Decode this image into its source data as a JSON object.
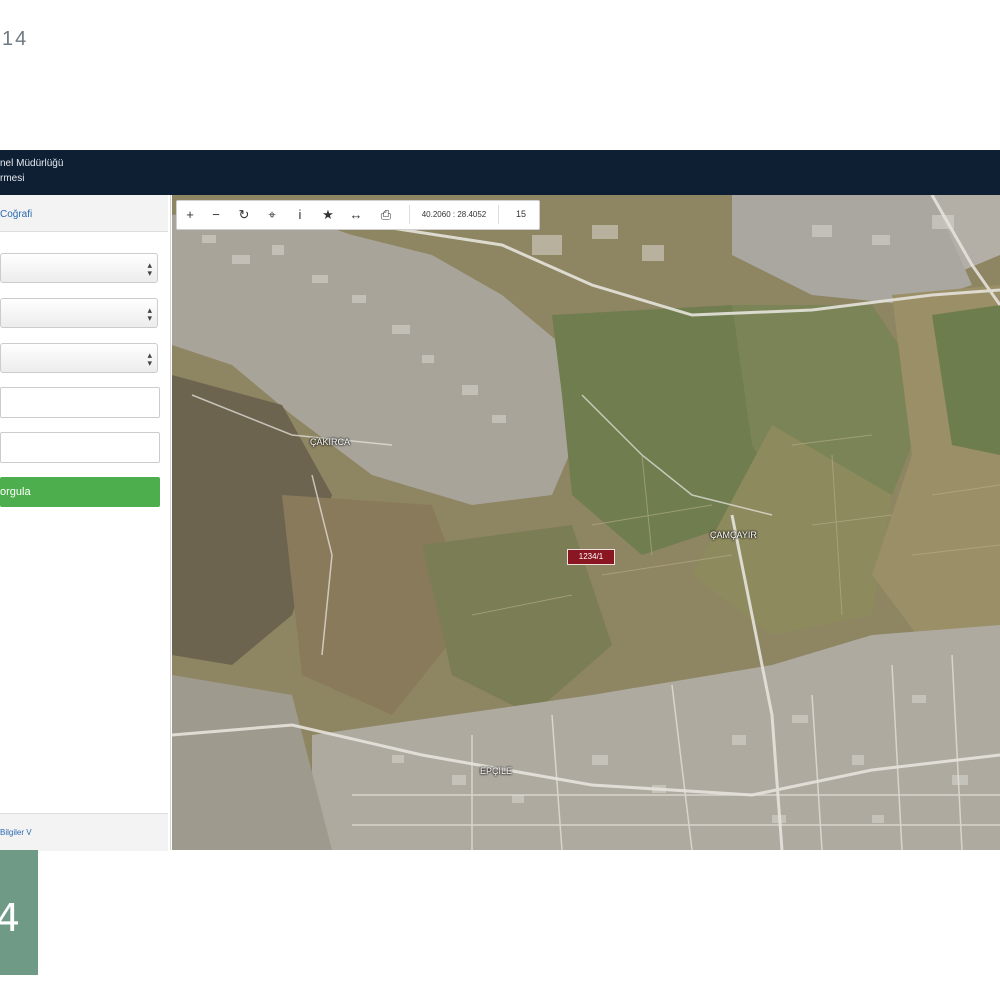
{
  "page": {
    "corner_number": "14"
  },
  "header": {
    "title_line1": "nel Müdürlüğü",
    "title_line2": "rmesi"
  },
  "sidebar": {
    "section_title": "Coğrafi",
    "selects": [
      "",
      "",
      ""
    ],
    "inputs": [
      "",
      ""
    ],
    "query_button": "orgula",
    "footer_link": "Bilgiler V"
  },
  "toolbar": {
    "icons": [
      "zoom-in-icon",
      "zoom-out-icon",
      "refresh-icon",
      "locate-icon",
      "info-icon",
      "star-icon",
      "measure-icon",
      "print-icon"
    ],
    "glyphs": [
      "+",
      "−",
      "↻",
      "⌖",
      "i",
      "★",
      "↔",
      "⎙"
    ],
    "coordinates": "40.2060 : 28.4052",
    "zoom_level": "15"
  },
  "map": {
    "parcel_label": "1234/1",
    "place_labels": [
      "ÇAKIRCA",
      "ÇAMÇAYIR",
      "EPÇILE"
    ]
  },
  "logo": {
    "glyph": "4"
  }
}
